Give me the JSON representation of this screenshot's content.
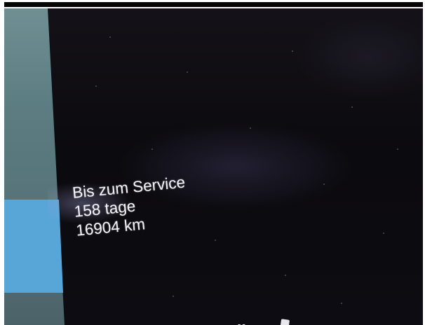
{
  "service": {
    "heading": "Bis zum Service",
    "days": "158 tage",
    "distance": "16904 km"
  },
  "colors": {
    "display_background": "#0d0c12",
    "text": "#f4f4f8",
    "accent_tile": "#58a5d8",
    "side_panel": "#5c7d82"
  },
  "icons": {
    "bottom_left": "infinity-like-icon",
    "bottom_right": "cup-icon"
  }
}
